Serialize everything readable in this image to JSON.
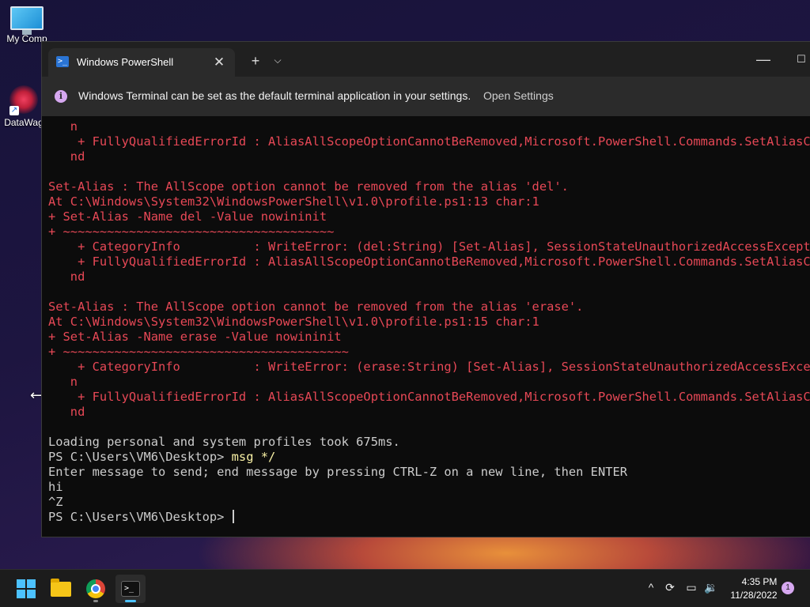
{
  "desktop": {
    "icons": [
      {
        "label": "My Comp",
        "icon": "computer-icon"
      },
      {
        "label": "DataWag",
        "icon": "app-shortcut-icon"
      }
    ]
  },
  "window": {
    "tab_title": "Windows PowerShell",
    "tab_close": "✕",
    "new_tab": "+",
    "dropdown": "⌵",
    "minimize": "—",
    "maximize": "☐"
  },
  "infobar": {
    "icon": "i",
    "message": "Windows Terminal can be set as the default terminal application in your settings.",
    "link": "Open Settings"
  },
  "console": {
    "lines": [
      {
        "text": "   n",
        "color": "red"
      },
      {
        "text": "    + FullyQualifiedErrorId : AliasAllScopeOptionCannotBeRemoved,Microsoft.PowerShell.Commands.SetAliasComma",
        "color": "red"
      },
      {
        "text": "   nd",
        "color": "red"
      },
      {
        "text": "",
        "color": "white"
      },
      {
        "text": "Set-Alias : The AllScope option cannot be removed from the alias 'del'.",
        "color": "red"
      },
      {
        "text": "At C:\\Windows\\System32\\WindowsPowerShell\\v1.0\\profile.ps1:13 char:1",
        "color": "red"
      },
      {
        "text": "+ Set-Alias -Name del -Value nowininit",
        "color": "red"
      },
      {
        "text": "+ ~~~~~~~~~~~~~~~~~~~~~~~~~~~~~~~~~~~~~",
        "color": "red"
      },
      {
        "text": "    + CategoryInfo          : WriteError: (del:String) [Set-Alias], SessionStateUnauthorizedAccessException",
        "color": "red"
      },
      {
        "text": "    + FullyQualifiedErrorId : AliasAllScopeOptionCannotBeRemoved,Microsoft.PowerShell.Commands.SetAliasComma",
        "color": "red"
      },
      {
        "text": "   nd",
        "color": "red"
      },
      {
        "text": "",
        "color": "white"
      },
      {
        "text": "Set-Alias : The AllScope option cannot be removed from the alias 'erase'.",
        "color": "red"
      },
      {
        "text": "At C:\\Windows\\System32\\WindowsPowerShell\\v1.0\\profile.ps1:15 char:1",
        "color": "red"
      },
      {
        "text": "+ Set-Alias -Name erase -Value nowininit",
        "color": "red"
      },
      {
        "text": "+ ~~~~~~~~~~~~~~~~~~~~~~~~~~~~~~~~~~~~~~~",
        "color": "red"
      },
      {
        "text": "    + CategoryInfo          : WriteError: (erase:String) [Set-Alias], SessionStateUnauthorizedAccessExcepti",
        "color": "red"
      },
      {
        "text": "   n",
        "color": "red"
      },
      {
        "text": "    + FullyQualifiedErrorId : AliasAllScopeOptionCannotBeRemoved,Microsoft.PowerShell.Commands.SetAliasComma",
        "color": "red"
      },
      {
        "text": "   nd",
        "color": "red"
      },
      {
        "text": "",
        "color": "white"
      },
      {
        "text": "Loading personal and system profiles took 675ms.",
        "color": "white"
      },
      {
        "text": "PS C:\\Users\\VM6\\Desktop> ",
        "color": "white",
        "command": "msg */"
      },
      {
        "text": "Enter message to send; end message by pressing CTRL-Z on a new line, then ENTER",
        "color": "white"
      },
      {
        "text": "hi",
        "color": "white"
      },
      {
        "text": "^Z",
        "color": "white"
      },
      {
        "text": "PS C:\\Users\\VM6\\Desktop> ",
        "color": "white",
        "cursor": true
      }
    ]
  },
  "taskbar": {
    "apps": [
      {
        "name": "start",
        "icon": "windows-logo-icon"
      },
      {
        "name": "file-explorer",
        "icon": "folder-icon"
      },
      {
        "name": "chrome",
        "icon": "chrome-icon"
      },
      {
        "name": "terminal",
        "icon": "terminal-icon",
        "active": true
      }
    ],
    "tray": {
      "chevron": "^",
      "update": "⟳",
      "network": "▭",
      "volume": "🔉"
    },
    "clock": {
      "time": "4:35 PM",
      "date": "11/28/2022"
    },
    "notifications": "1"
  },
  "colors": {
    "error_red": "#e74856",
    "console_text": "#cccccc",
    "command_yellow": "#f9f1a5",
    "console_bg": "#0c0c0c",
    "accent": "#4cc2ff"
  }
}
